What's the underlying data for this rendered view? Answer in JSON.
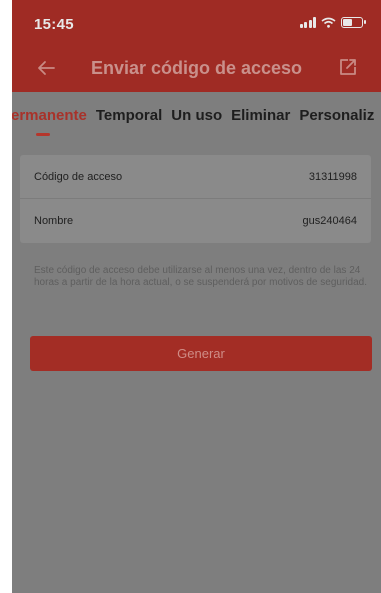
{
  "status_bar": {
    "time": "15:45"
  },
  "nav": {
    "title": "Enviar código de acceso"
  },
  "tabs": [
    {
      "label": "Permanente",
      "active": true
    },
    {
      "label": "Temporal",
      "active": false
    },
    {
      "label": "Un uso",
      "active": false
    },
    {
      "label": "Eliminar",
      "active": false
    },
    {
      "label": "Personaliz",
      "active": false
    }
  ],
  "form": {
    "access_code_label": "Código de acceso",
    "access_code_value": "31311998",
    "name_label": "Nombre",
    "name_value": "gus240464"
  },
  "note": "Este código de acceso debe utilizarse al menos una vez, dentro de las 24 horas a partir de la hora actual, o se suspenderá por motivos de seguridad.",
  "generate_button": "Generar",
  "colors": {
    "header": "#9f2b24",
    "accent": "#a8322a",
    "overlay": "#7e7e7e"
  },
  "icons": {
    "back": "arrow-left-icon",
    "share": "share-icon"
  }
}
